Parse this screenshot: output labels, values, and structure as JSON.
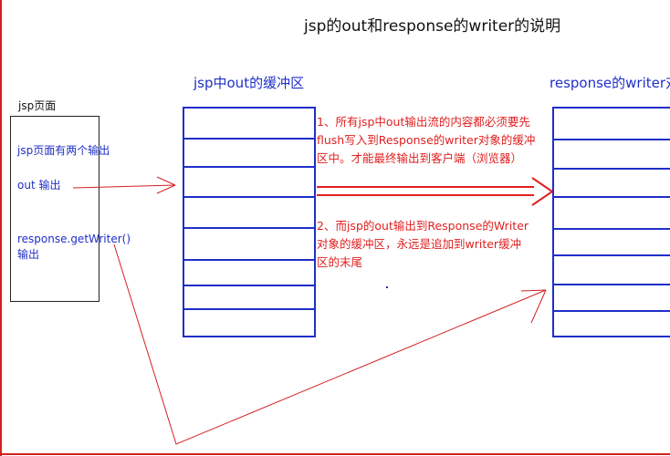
{
  "title": "jsp的out和response的writer的说明",
  "jsp_page": {
    "label": "jsp页面",
    "lines": [
      "jsp页面有两个输出",
      "out 输出",
      "response.getWriter()",
      "输出"
    ]
  },
  "out_buffer": {
    "title": "jsp中out的缓冲区"
  },
  "writer_buffer": {
    "title": "response的writer对"
  },
  "notes": {
    "note1": [
      "1、所有jsp中out输出流的内容都必须要先",
      "flush写入到Response的writer对象的缓冲",
      "区中。才能最终输出到客户端（浏览器）"
    ],
    "note2": [
      "2、而jsp的out输出到Response的Writer",
      "对象的缓冲区，永远是追加到writer缓冲",
      "区的末尾"
    ]
  },
  "colors": {
    "blue": "#1f2fc8",
    "red": "#e02020",
    "frame": "#d42020"
  }
}
